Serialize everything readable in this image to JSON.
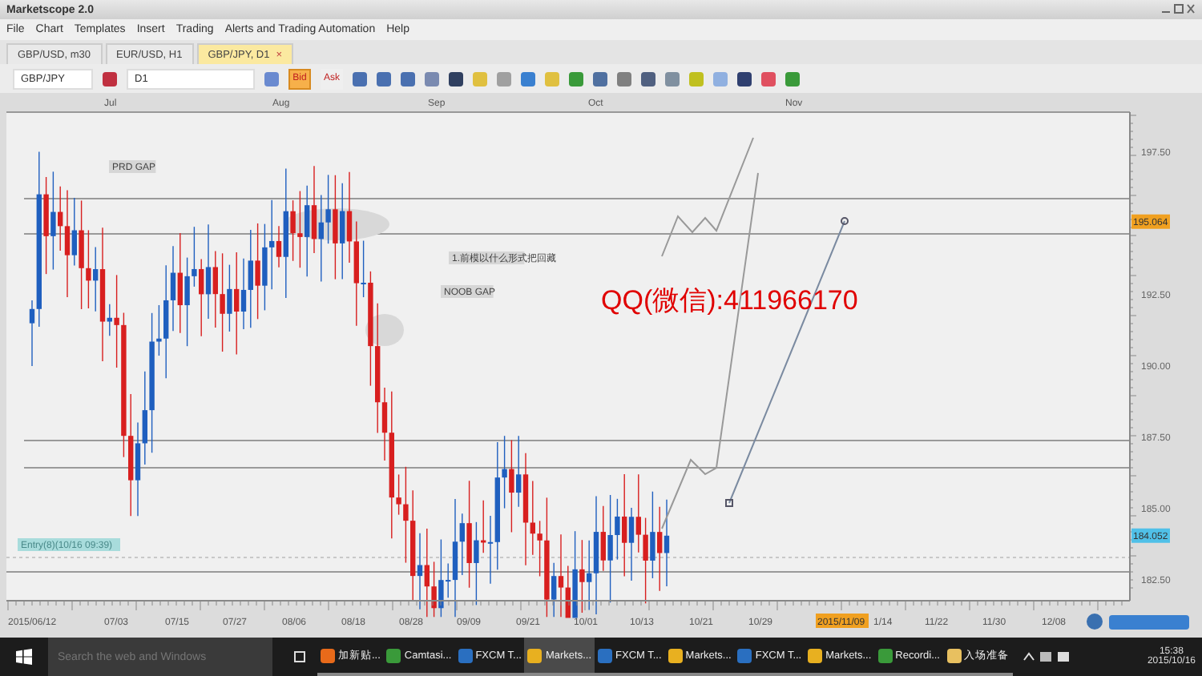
{
  "window": {
    "title": "Marketscope 2.0"
  },
  "menu": [
    "File",
    "Chart",
    "Templates",
    "Insert",
    "Trading",
    "Alerts and Trading Automation",
    "Help"
  ],
  "tabs": [
    {
      "label": "GBP/USD, m30",
      "selected": false
    },
    {
      "label": "EUR/USD, H1",
      "selected": false
    },
    {
      "label": "GBP/JPY, D1",
      "selected": true,
      "close": "×"
    }
  ],
  "toolbar": {
    "symbol": "GBP/JPY",
    "period": "D1",
    "price_buttons": [
      {
        "label": "Bid",
        "selected": true
      },
      {
        "label": "Ask",
        "selected": false
      }
    ]
  },
  "chart": {
    "month_labels": [
      "Jul",
      "Aug",
      "Sep",
      "Oct",
      "Nov"
    ],
    "price_labels": [
      "197.50",
      "192.50",
      "190.00",
      "187.50",
      "185.00",
      "182.50"
    ],
    "price_tags": [
      {
        "label": "195.064",
        "kind": "last"
      },
      {
        "label": "184.052",
        "kind": "entry"
      }
    ],
    "date_labels": [
      "2015/06/12",
      "07/03",
      "07/15",
      "07/27",
      "08/06",
      "08/18",
      "08/28",
      "09/09",
      "09/21",
      "10/01",
      "10/13",
      "10/21",
      "10/29",
      "1/14",
      "11/22",
      "11/30",
      "12/08"
    ],
    "date_tag": "2015/11/09",
    "annotations": [
      {
        "kind": "label",
        "text": "PRD GAP"
      },
      {
        "kind": "label",
        "text": "1.前模以什么形式把回藏"
      },
      {
        "kind": "label",
        "text": "NOOB GAP"
      },
      {
        "kind": "entry",
        "text": "Entry(8)(10/16 09:39)"
      },
      {
        "kind": "overlay",
        "text": "QQ(微信):411966170"
      }
    ]
  },
  "taskbar": {
    "search": {
      "placeholder": "Search the web and Windows"
    },
    "items": [
      {
        "label": "加新贴...",
        "kind": "browser",
        "selected": false
      },
      {
        "label": "Camtasi...",
        "kind": "camtasia",
        "selected": false
      },
      {
        "label": "FXCM T...",
        "kind": "fxcm",
        "selected": false
      },
      {
        "label": "Markets...",
        "kind": "marketscope",
        "selected": true
      },
      {
        "label": "FXCM T...",
        "kind": "fxcm",
        "selected": false
      },
      {
        "label": "Markets...",
        "kind": "marketscope",
        "selected": false
      },
      {
        "label": "FXCM T...",
        "kind": "fxcm",
        "selected": false
      },
      {
        "label": "Markets...",
        "kind": "marketscope",
        "selected": false
      },
      {
        "label": "Recordi...",
        "kind": "camtasia",
        "selected": false
      },
      {
        "label": "入场准备",
        "kind": "folder",
        "selected": false
      }
    ],
    "time": "15:38",
    "date": "2015/10/16"
  }
}
